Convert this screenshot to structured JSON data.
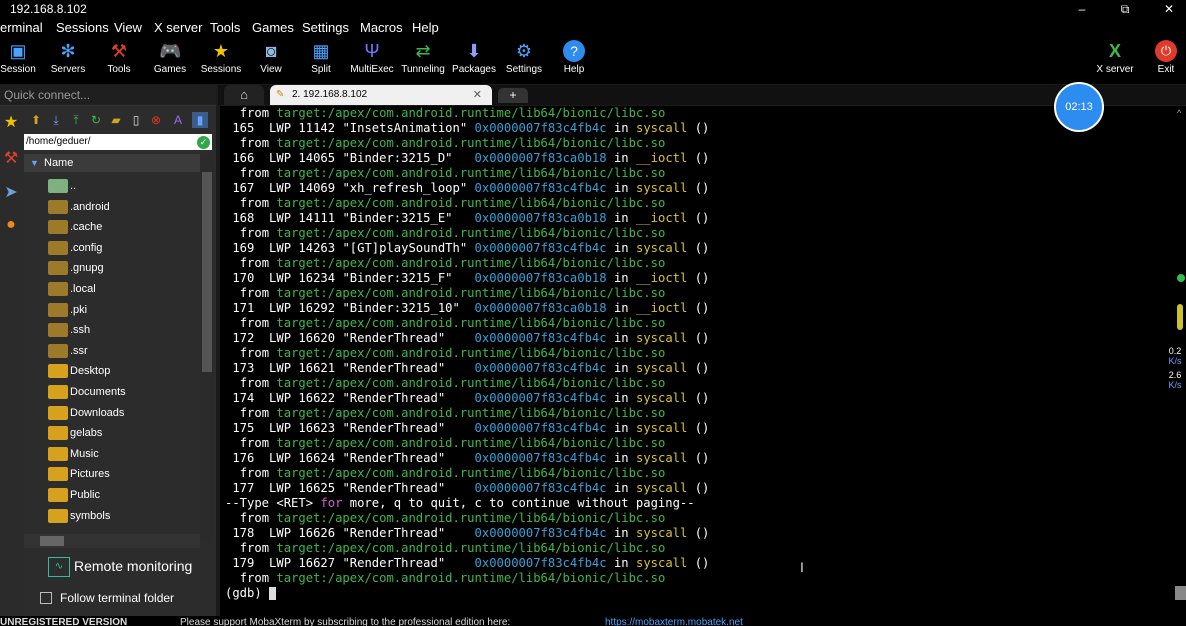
{
  "window": {
    "title": "192.168.8.102",
    "minimize": "–",
    "maximize": "⧉",
    "close": "✕"
  },
  "menu": [
    "erminal",
    "Sessions",
    "View",
    "X server",
    "Tools",
    "Games",
    "Settings",
    "Macros",
    "Help"
  ],
  "toolbar": [
    {
      "label": "Session",
      "icon": "session-icon"
    },
    {
      "label": "Servers",
      "icon": "servers-icon"
    },
    {
      "label": "Tools",
      "icon": "tools-icon"
    },
    {
      "label": "Games",
      "icon": "games-icon"
    },
    {
      "label": "Sessions",
      "icon": "star-icon"
    },
    {
      "label": "View",
      "icon": "view-icon"
    },
    {
      "label": "Split",
      "icon": "split-icon"
    },
    {
      "label": "MultiExec",
      "icon": "multiexec-icon"
    },
    {
      "label": "Tunneling",
      "icon": "tunneling-icon"
    },
    {
      "label": "Packages",
      "icon": "packages-icon"
    },
    {
      "label": "Settings",
      "icon": "settings-icon"
    },
    {
      "label": "Help",
      "icon": "help-icon"
    }
  ],
  "toolbar_right": [
    {
      "label": "X server",
      "icon": "xserver-icon"
    },
    {
      "label": "Exit",
      "icon": "exit-icon"
    }
  ],
  "quick_connect": {
    "placeholder": "Quick connect..."
  },
  "tabs": {
    "session_tab": "2. 192.168.8.102"
  },
  "file_browser": {
    "path": "/home/geduer/",
    "column_header": "Name",
    "items": [
      {
        "name": "..",
        "kind": "parent"
      },
      {
        "name": ".android",
        "kind": "hidden"
      },
      {
        "name": ".cache",
        "kind": "hidden"
      },
      {
        "name": ".config",
        "kind": "hidden"
      },
      {
        "name": ".gnupg",
        "kind": "hidden"
      },
      {
        "name": ".local",
        "kind": "hidden"
      },
      {
        "name": ".pki",
        "kind": "hidden"
      },
      {
        "name": ".ssh",
        "kind": "hidden"
      },
      {
        "name": ".ssr",
        "kind": "hidden"
      },
      {
        "name": "Desktop",
        "kind": "folder"
      },
      {
        "name": "Documents",
        "kind": "folder"
      },
      {
        "name": "Downloads",
        "kind": "folder"
      },
      {
        "name": "gelabs",
        "kind": "folder"
      },
      {
        "name": "Music",
        "kind": "folder"
      },
      {
        "name": "Pictures",
        "kind": "folder"
      },
      {
        "name": "Public",
        "kind": "folder"
      },
      {
        "name": "symbols",
        "kind": "folder"
      }
    ],
    "remote_monitoring": "Remote monitoring",
    "follow_folder": "Follow terminal folder"
  },
  "terminal": {
    "first_from": "target:/apex/com.android.runtime/lib64/bionic/libc.so",
    "threads": [
      {
        "num": "165",
        "lwp": "11142",
        "name": "\"InsetsAnimation\"",
        "addr": "0x0000007f83c4fb4c",
        "fn": "syscall"
      },
      {
        "num": "166",
        "lwp": "14065",
        "name": "\"Binder:3215_D\"",
        "addr": "0x0000007f83ca0b18",
        "fn": "__ioctl"
      },
      {
        "num": "167",
        "lwp": "14069",
        "name": "\"xh_refresh_loop\"",
        "addr": "0x0000007f83c4fb4c",
        "fn": "syscall"
      },
      {
        "num": "168",
        "lwp": "14111",
        "name": "\"Binder:3215_E\"",
        "addr": "0x0000007f83ca0b18",
        "fn": "__ioctl"
      },
      {
        "num": "169",
        "lwp": "14263",
        "name": "\"[GT]playSoundTh\"",
        "addr": "0x0000007f83c4fb4c",
        "fn": "syscall"
      },
      {
        "num": "170",
        "lwp": "16234",
        "name": "\"Binder:3215_F\"",
        "addr": "0x0000007f83ca0b18",
        "fn": "__ioctl"
      },
      {
        "num": "171",
        "lwp": "16292",
        "name": "\"Binder:3215_10\"",
        "addr": "0x0000007f83ca0b18",
        "fn": "__ioctl"
      },
      {
        "num": "172",
        "lwp": "16620",
        "name": "\"RenderThread\"",
        "addr": "0x0000007f83c4fb4c",
        "fn": "syscall"
      },
      {
        "num": "173",
        "lwp": "16621",
        "name": "\"RenderThread\"",
        "addr": "0x0000007f83c4fb4c",
        "fn": "syscall"
      },
      {
        "num": "174",
        "lwp": "16622",
        "name": "\"RenderThread\"",
        "addr": "0x0000007f83c4fb4c",
        "fn": "syscall"
      },
      {
        "num": "175",
        "lwp": "16623",
        "name": "\"RenderThread\"",
        "addr": "0x0000007f83c4fb4c",
        "fn": "syscall"
      },
      {
        "num": "176",
        "lwp": "16624",
        "name": "\"RenderThread\"",
        "addr": "0x0000007f83c4fb4c",
        "fn": "syscall"
      },
      {
        "num": "177",
        "lwp": "16625",
        "name": "\"RenderThread\"",
        "addr": "0x0000007f83c4fb4c",
        "fn": "syscall"
      },
      {
        "num": "178",
        "lwp": "16626",
        "name": "\"RenderThread\"",
        "addr": "0x0000007f83c4fb4c",
        "fn": "syscall"
      },
      {
        "num": "179",
        "lwp": "16627",
        "name": "\"RenderThread\"",
        "addr": "0x0000007f83c4fb4c",
        "fn": "syscall"
      }
    ],
    "from_word": "from",
    "in_word": "in",
    "args": "()",
    "lwp_word": "LWP",
    "paging_prefix": "--Type <RET> ",
    "paging_for": "for",
    "paging_suffix": " more, q to quit, c to continue without paging--",
    "prompt": "(gdb) "
  },
  "timer": "02:13",
  "net": {
    "up": "0.2",
    "down": "2.6",
    "unit": "K/s"
  },
  "status": {
    "version": "UNREGISTERED VERSION",
    "message": "Please support MobaXterm by subscribing to the professional edition here:",
    "link": "https://mobaxterm.mobatek.net"
  },
  "colors": {
    "green": "#3fb84a",
    "blue": "#3aa0d8",
    "yellow": "#d8c23a",
    "magenta": "#d060d0",
    "folder": "#d6a21e"
  }
}
